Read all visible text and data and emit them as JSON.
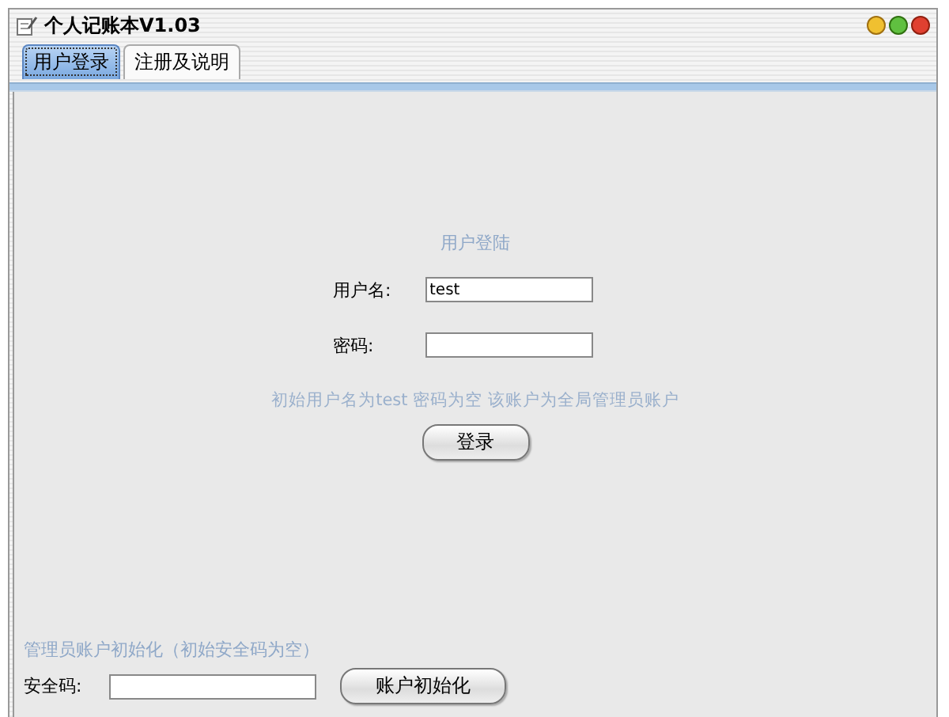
{
  "window": {
    "title": "个人记账本V1.03"
  },
  "tabs": [
    {
      "label": "用户登录",
      "selected": true
    },
    {
      "label": "注册及说明",
      "selected": false
    }
  ],
  "login": {
    "heading": "用户登陆",
    "username_label": "用户名:",
    "username_value": "test",
    "password_label": "密码:",
    "hint": "初始用户名为test 密码为空 该账户为全局管理员账户",
    "button": "登录"
  },
  "admin": {
    "heading": "管理员账户初始化（初始安全码为空）",
    "code_label": "安全码:",
    "button": "账户初始化"
  }
}
